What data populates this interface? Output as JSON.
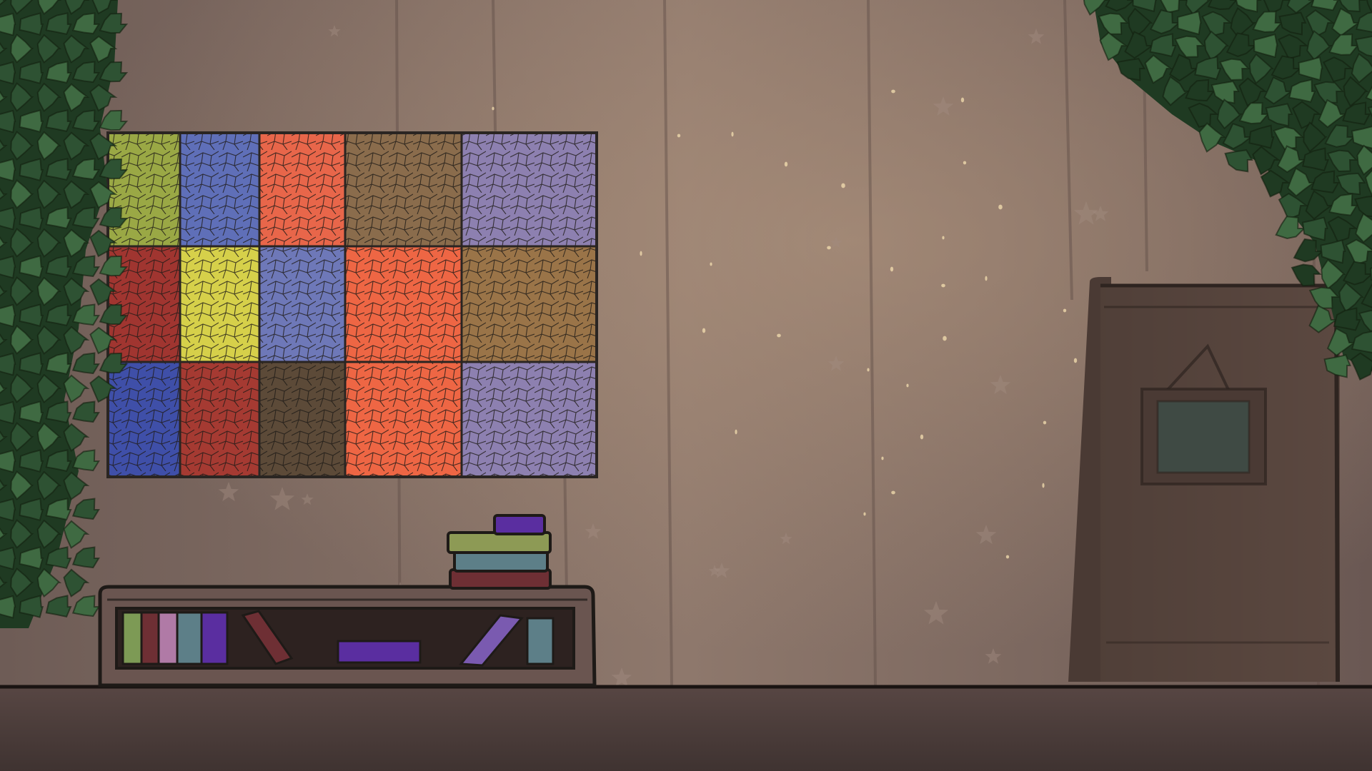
{
  "scene": {
    "type": "point-and-click room",
    "description_visible_text": ""
  },
  "colors": {
    "wall": "#8a7468",
    "wall_dark": "#5e4d47",
    "floor": "#4e403d",
    "floor_line": "#1a1412",
    "foliage_dark": "#1f3a22",
    "foliage_mid": "#2e5233",
    "foliage_light": "#3f6a42",
    "outline": "#1e1a17"
  },
  "stained_glass": {
    "panels": [
      [
        "#9aa845",
        "#5f6fb8",
        "#e8664a",
        "#8a6c4c",
        "#8d80b0"
      ],
      [
        "#a03530",
        "#d6d04a",
        "#6e78b8",
        "#ee6644",
        "#9a7448"
      ],
      [
        "#3f4fa8",
        "#a53a32",
        "#5c4a38",
        "#ee6644",
        "#8d80b0"
      ]
    ]
  },
  "bookshelf": {
    "books_left": [
      "#7d9a55",
      "#6e2f34",
      "#b07aa6",
      "#5d7f88",
      "#5a2ea0"
    ],
    "book_leaning": "#6e2f34",
    "book_flat": "#5a2ea0",
    "book_right_leaning": "#7a5ab0",
    "book_right": "#5d7f88",
    "stack": [
      "#6e2f34",
      "#5d7f88",
      "#8d9a55",
      "#5a2ea0"
    ]
  },
  "door": {
    "color": "#5b4840",
    "frame_color": "#4a3a34",
    "sign_color": "#3f4a44"
  }
}
